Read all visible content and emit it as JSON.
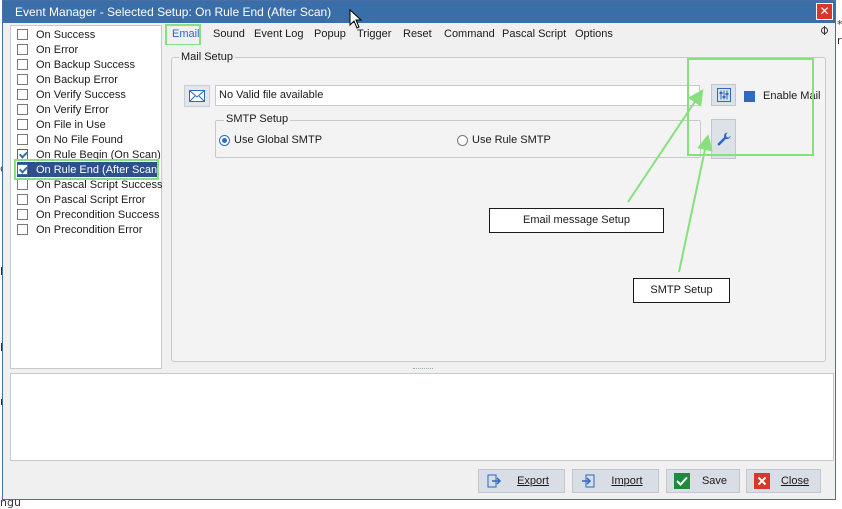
{
  "window": {
    "title": "Event Manager - Selected Setup: On Rule End (After Scan)",
    "close_glyph": "✕"
  },
  "background_glyphs": [
    "*",
    "r",
    "c",
    "p",
    "h",
    "n",
    "ngu"
  ],
  "events": [
    {
      "label": "On Success",
      "checked": false
    },
    {
      "label": "On Error",
      "checked": false
    },
    {
      "label": "On Backup Success",
      "checked": false
    },
    {
      "label": "On Backup Error",
      "checked": false
    },
    {
      "label": "On Verify Success",
      "checked": false
    },
    {
      "label": "On Verify Error",
      "checked": false
    },
    {
      "label": "On File in Use",
      "checked": false
    },
    {
      "label": "On No File Found",
      "checked": false
    },
    {
      "label": "On Rule Begin (On Scan)",
      "checked": true
    },
    {
      "label": "On Rule End (After Scan)",
      "checked": true,
      "selected": true
    },
    {
      "label": "On Pascal Script Success",
      "checked": false
    },
    {
      "label": "On Pascal Script Error",
      "checked": false
    },
    {
      "label": "On Precondition Success",
      "checked": false
    },
    {
      "label": "On Precondition Error",
      "checked": false
    }
  ],
  "tabs": [
    {
      "label": "Email",
      "active": true
    },
    {
      "label": "Sound"
    },
    {
      "label": "Event Log"
    },
    {
      "label": "Popup"
    },
    {
      "label": "Trigger"
    },
    {
      "label": "Reset"
    },
    {
      "label": "Command"
    },
    {
      "label": "Pascal Script"
    },
    {
      "label": "Options"
    }
  ],
  "mail_setup": {
    "legend": "Mail Setup",
    "file_value": "No Valid file available",
    "enable_mail_label": "Enable Mail",
    "enable_mail_checked": true,
    "smtp": {
      "legend": "SMTP Setup",
      "use_global_label": "Use Global SMTP",
      "use_rule_label": "Use Rule SMTP",
      "selected": "global"
    }
  },
  "callouts": {
    "email_setup": "Email message Setup",
    "smtp_setup": "SMTP Setup"
  },
  "footer": {
    "export": "Export",
    "import": "Import",
    "save": "Save",
    "close": "Close"
  },
  "colors": {
    "titlebar": "#3a6ea8",
    "highlight": "#86e07e",
    "selected_row": "#2f4f8f",
    "accent": "#2c68c6"
  }
}
